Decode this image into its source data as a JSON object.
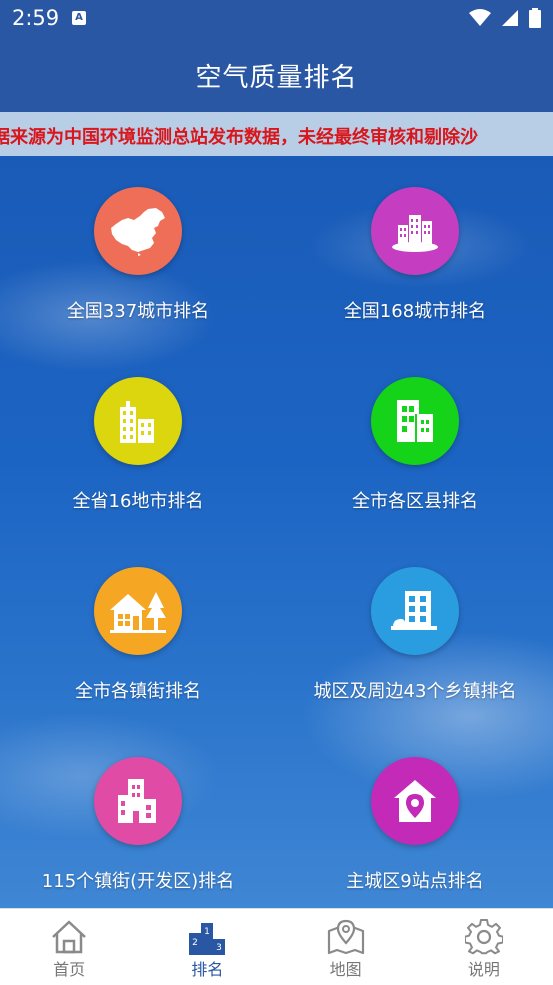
{
  "status_bar": {
    "time": "2:59",
    "notification_letter": "A"
  },
  "header": {
    "title": "空气质量排名"
  },
  "marquee": {
    "text": "据来源为中国环境监测总站发布数据，未经最终审核和剔除沙"
  },
  "tiles": [
    {
      "label": "全国337城市排名",
      "color": "#ef6e57",
      "icon": "china-map-icon"
    },
    {
      "label": "全国168城市排名",
      "color": "#c53ec2",
      "icon": "city-buildings-icon"
    },
    {
      "label": "全省16地市排名",
      "color": "#dcd60f",
      "icon": "buildings-icon"
    },
    {
      "label": "全市各区县排名",
      "color": "#15d319",
      "icon": "office-building-icon"
    },
    {
      "label": "全市各镇街排名",
      "color": "#f5a623",
      "icon": "town-house-tree-icon"
    },
    {
      "label": "城区及周边43个乡镇排名",
      "color": "#2a9de0",
      "icon": "apartment-icon"
    },
    {
      "label": "115个镇街(开发区)排名",
      "color": "#e04ba6",
      "icon": "district-building-icon"
    },
    {
      "label": "主城区9站点排名",
      "color": "#c42ab8",
      "icon": "location-home-icon"
    }
  ],
  "bottom_nav": {
    "items": [
      {
        "label": "首页",
        "icon": "home-icon"
      },
      {
        "label": "排名",
        "icon": "podium-icon",
        "active": true
      },
      {
        "label": "地图",
        "icon": "map-pin-icon"
      },
      {
        "label": "说明",
        "icon": "gear-icon"
      }
    ],
    "active_color": "#2a57a3",
    "inactive_color": "#777777"
  }
}
